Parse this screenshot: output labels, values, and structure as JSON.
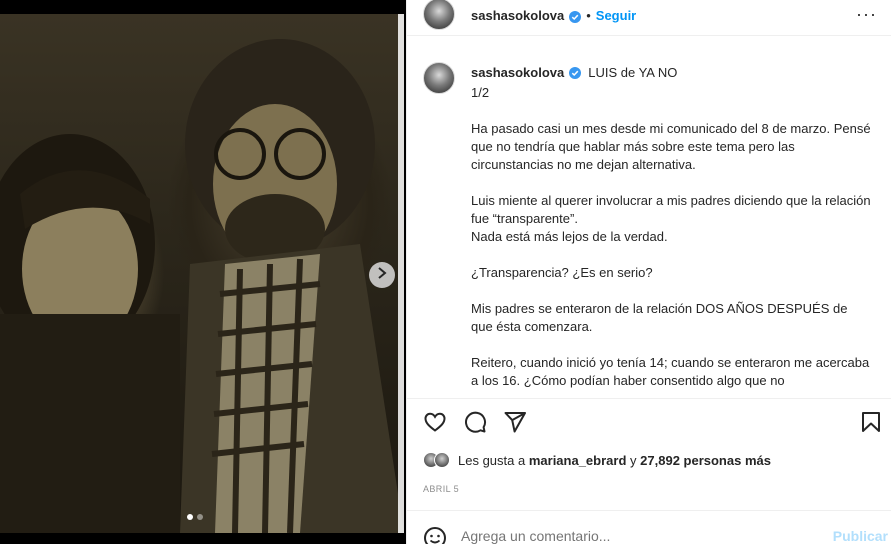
{
  "post": {
    "username": "sashasokolova",
    "follow_label": "Seguir",
    "separator": "•",
    "more_label": "···"
  },
  "caption": {
    "username": "sashasokolova",
    "title": "LUIS de YA NO",
    "paragraphs": [
      "1/2",
      "Ha pasado casi un mes desde mi comunicado del 8 de marzo. Pensé que no tendría que hablar más sobre este tema pero las circunstancias no me dejan alternativa.",
      "Luis miente al querer involucrar a mis padres diciendo que la relación fue “transparente”.\nNada está más lejos de la verdad.",
      "¿Transparencia? ¿Es en serio?",
      "Mis padres se enteraron de la relación DOS AÑOS DESPUÉS de que ésta comenzara.",
      "Reitero, cuando inició yo tenía 14; cuando se enteraron me acercaba a los 16. ¿Cómo podían haber consentido algo que no"
    ]
  },
  "likes": {
    "prefix": "Les gusta a",
    "user": "mariana_ebrard",
    "conjunction": "y",
    "count": "27,892 personas más"
  },
  "date": "ABRIL 5",
  "comment": {
    "placeholder": "Agrega un comentario...",
    "publish_label": "Publicar"
  },
  "carousel": {
    "total": 2,
    "current": 1
  },
  "icons": [
    "verified-badge-icon",
    "more-options-icon",
    "heart-icon",
    "comment-icon",
    "share-icon",
    "bookmark-icon",
    "emoji-icon",
    "chevron-right-icon"
  ],
  "colors": {
    "accent": "#0095f6",
    "verified": "#3897f0",
    "publish_disabled": "#b2dffc",
    "muted": "#8e8e8e"
  }
}
